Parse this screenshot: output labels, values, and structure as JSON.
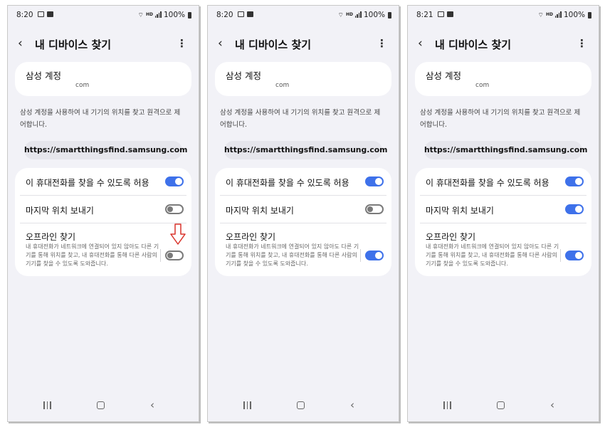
{
  "screens": [
    {
      "status": {
        "time": "8:20",
        "hd": "HD",
        "battery": "100%"
      },
      "header": {
        "back": "‹",
        "title": "내 디바이스 찾기",
        "more": "⋮"
      },
      "account": {
        "label": "삼성 계정",
        "email": "com"
      },
      "description": "삼성 계정을 사용하여 내 기기의 위치를 찾고 원격으로 제어합니다.",
      "url": "https://smartthingsfind.samsung.com",
      "settings": [
        {
          "label": "이 휴대전화를 찾을 수 있도록 허용",
          "on": true
        },
        {
          "label": "마지막 위치 보내기",
          "on": false
        },
        {
          "label": "오프라인 찾기",
          "description": "내 휴대전화가 네트워크에 연결되어 있지 않아도 다른 기기를 통해 위치를 찾고, 내 휴대전화를 통해 다른 사람의 기기를 찾을 수 있도록 도와줍니다.",
          "on": false
        }
      ],
      "highlight_arrow": true
    },
    {
      "status": {
        "time": "8:20",
        "hd": "HD",
        "battery": "100%"
      },
      "header": {
        "back": "‹",
        "title": "내 디바이스 찾기",
        "more": "⋮"
      },
      "account": {
        "label": "삼성 계정",
        "email": "com"
      },
      "description": "삼성 계정을 사용하여 내 기기의 위치를 찾고 원격으로 제어합니다.",
      "url": "https://smartthingsfind.samsung.com",
      "settings": [
        {
          "label": "이 휴대전화를 찾을 수 있도록 허용",
          "on": true
        },
        {
          "label": "마지막 위치 보내기",
          "on": false
        },
        {
          "label": "오프라인 찾기",
          "description": "내 휴대전화가 네트워크에 연결되어 있지 않아도 다른 기기를 통해 위치를 찾고, 내 휴대전화를 통해 다른 사람의 기기를 찾을 수 있도록 도와줍니다.",
          "on": true
        }
      ],
      "highlight_arrow": false
    },
    {
      "status": {
        "time": "8:21",
        "hd": "HD",
        "battery": "100%"
      },
      "header": {
        "back": "‹",
        "title": "내 디바이스 찾기",
        "more": "⋮"
      },
      "account": {
        "label": "삼성 계정",
        "email": "com"
      },
      "description": "삼성 계정을 사용하여 내 기기의 위치를 찾고 원격으로 제어합니다.",
      "url": "https://smartthingsfind.samsung.com",
      "settings": [
        {
          "label": "이 휴대전화를 찾을 수 있도록 허용",
          "on": true
        },
        {
          "label": "마지막 위치 보내기",
          "on": true
        },
        {
          "label": "오프라인 찾기",
          "description": "내 휴대전화가 네트워크에 연결되어 있지 않아도 다른 기기를 통해 위치를 찾고, 내 휴대전화를 통해 다른 사람의 기기를 찾을 수 있도록 도와줍니다.",
          "on": true
        }
      ],
      "highlight_arrow": false
    }
  ],
  "colors": {
    "toggle_on": "#3e71ea",
    "toggle_off": "#7a7a7a",
    "arrow": "#d9342b",
    "background": "#f2f2f7"
  },
  "icons": {
    "back": "chevron-left-icon",
    "more": "more-vertical-icon",
    "arrow": "down-arrow-icon",
    "nav_recent": "recent-apps-icon",
    "nav_home": "home-icon",
    "nav_back": "back-icon"
  }
}
